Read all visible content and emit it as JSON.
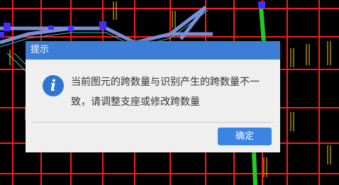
{
  "dialog": {
    "title": "提示",
    "icon": "info-icon",
    "message": "当前图元的跨数量与识别产生的跨数量不一致，请调整支座或修改跨数量",
    "ok_label": "确定"
  },
  "colors": {
    "background": "#000000",
    "grid_line": "#ff1a1a",
    "beam": "#7a8fd8",
    "column": "#4a2cff",
    "highlight_beam": "#22cc22",
    "annotation": "#ffd400",
    "dialog_title": "#3c7ed6",
    "button": "#3a84e4"
  }
}
